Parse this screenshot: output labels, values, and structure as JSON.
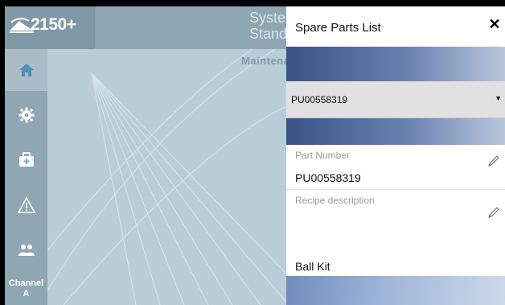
{
  "background_app": {
    "brand_text": "2150+",
    "system_title": "System",
    "system_subtitle": "Standby",
    "section_label": "Maintenance",
    "sidebar": {
      "items": [
        {
          "icon": "home-icon",
          "active": true
        },
        {
          "icon": "gear-icon"
        },
        {
          "icon": "toolkit-icon"
        },
        {
          "icon": "warning-icon"
        },
        {
          "icon": "users-icon"
        }
      ],
      "channel_label": "Channel",
      "channel_value": "A"
    }
  },
  "panel": {
    "title": "Spare Parts List",
    "close_glyph": "✕",
    "select": {
      "value": "PU00558319",
      "caret": "▼"
    },
    "fields": {
      "part_number": {
        "label": "Part Number",
        "value": "PU00558319"
      },
      "recipe_description": {
        "label": "Recipe description",
        "value": "Ball Kit"
      }
    }
  },
  "colors": {
    "overlay_background": "#b9cdd8",
    "sidebar": "#8fa7b3",
    "band_dark": "#3a5286",
    "band_light": "#b9c6dd",
    "select_background": "#e1e1e1"
  }
}
